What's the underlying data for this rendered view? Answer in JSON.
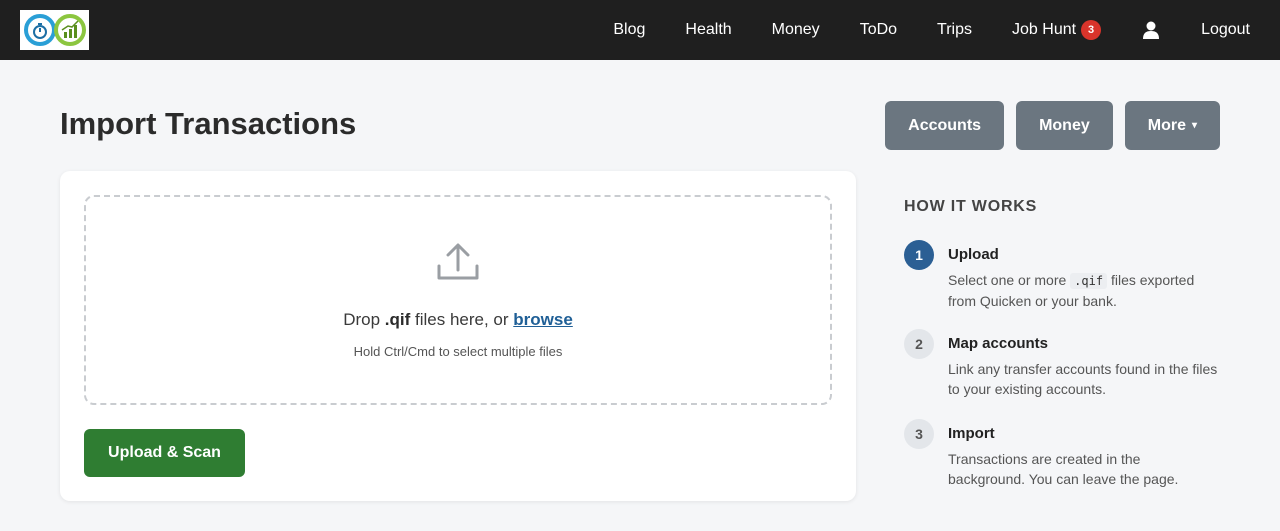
{
  "nav": {
    "logo_alt": "app logo",
    "links": [
      {
        "label": "Blog"
      },
      {
        "label": "Health"
      },
      {
        "label": "Money"
      },
      {
        "label": "ToDo"
      },
      {
        "label": "Trips"
      },
      {
        "label": "Job Hunt",
        "badge": "3"
      }
    ],
    "logout_label": "Logout"
  },
  "header": {
    "title": "Import Transactions",
    "buttons": {
      "accounts": "Accounts",
      "money": "Money",
      "more": "More",
      "more_caret": "▾"
    }
  },
  "upload": {
    "drop_prefix": "Drop ",
    "drop_ext": ".qif",
    "drop_middle": " files here, or ",
    "browse_label": "browse",
    "hint": "Hold Ctrl/Cmd to select multiple files",
    "button_label": "Upload & Scan"
  },
  "how": {
    "title": "HOW IT WORKS",
    "steps": [
      {
        "num": "1",
        "title": "Upload",
        "desc_before": "Select one or more ",
        "code": ".qif",
        "desc_after": " files exported from Quicken or your bank."
      },
      {
        "num": "2",
        "title": "Map accounts",
        "desc": "Link any transfer accounts found in the files to your existing accounts."
      },
      {
        "num": "3",
        "title": "Import",
        "desc": "Transactions are created in the background. You can leave the page."
      }
    ]
  },
  "colors": {
    "navbar": "#1f1f1f",
    "badge": "#d9342b",
    "header_button": "#6b7680",
    "primary_green": "#2f7d32",
    "link_blue": "#1f5f96",
    "step_active": "#2b5f94"
  }
}
